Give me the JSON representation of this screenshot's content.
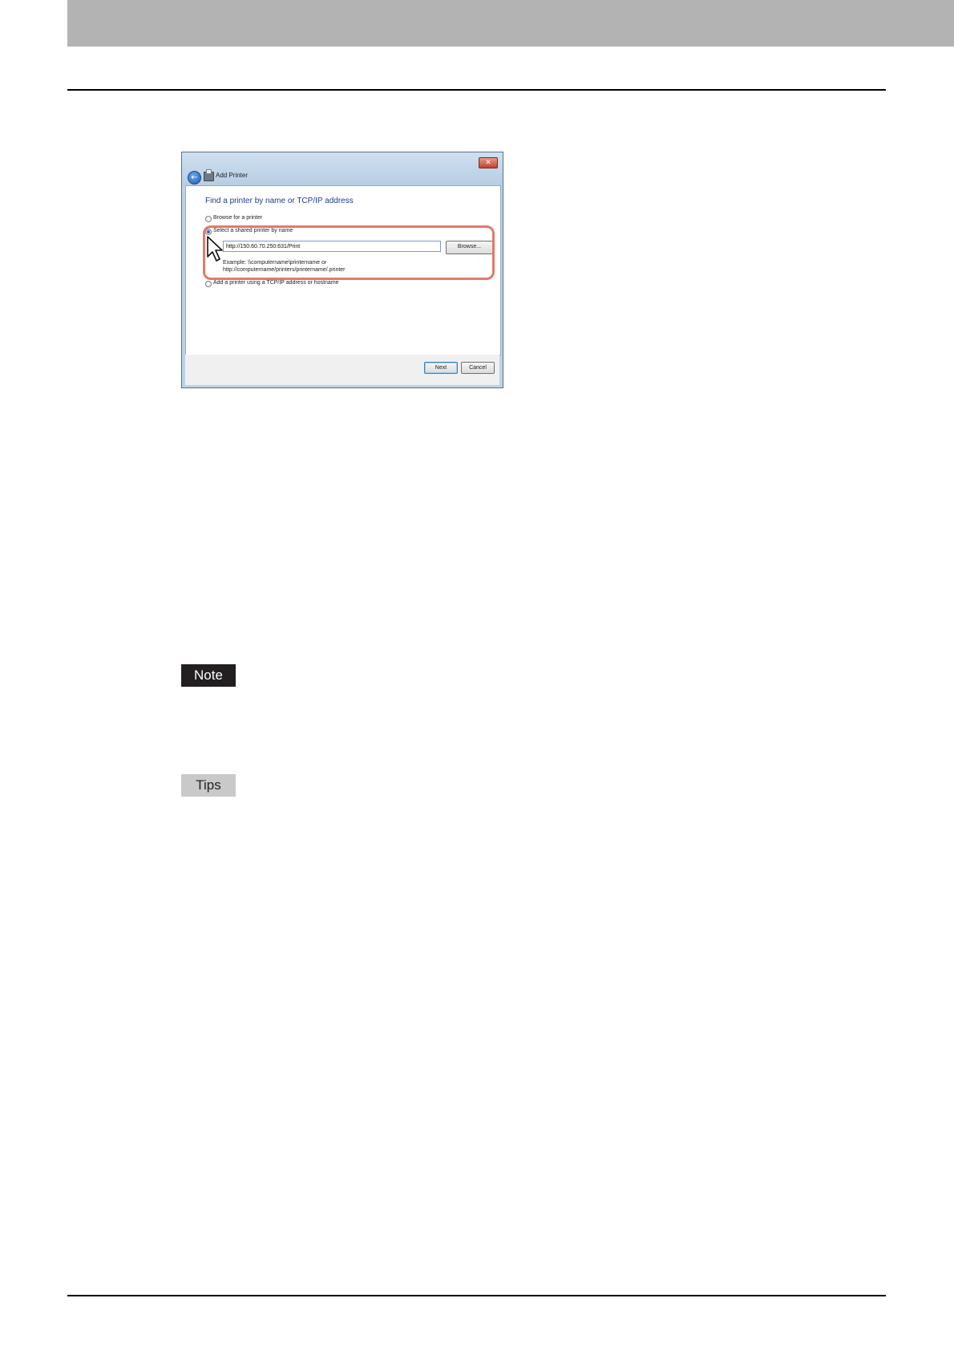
{
  "dialog": {
    "close_glyph": "✕",
    "back_glyph": "←",
    "title": "Add Printer",
    "heading": "Find a printer by name or TCP/IP address",
    "options": [
      {
        "label": "Browse for a printer",
        "selected": false
      },
      {
        "label": "Select a shared printer by name",
        "selected": true
      },
      {
        "label": "Add a printer using a TCP/IP address or hostname",
        "selected": false
      }
    ],
    "url_value": "http://150.60.70.250:631/Print",
    "browse_label": "Browse...",
    "example_line1": "Example: \\\\computername\\printername or",
    "example_line2": "http://computername/printers/printername/.printer",
    "next_label": "Next",
    "cancel_label": "Cancel",
    "highlight_color": "#e17a6a"
  },
  "note_badge": "Note",
  "tips_badge": "Tips"
}
